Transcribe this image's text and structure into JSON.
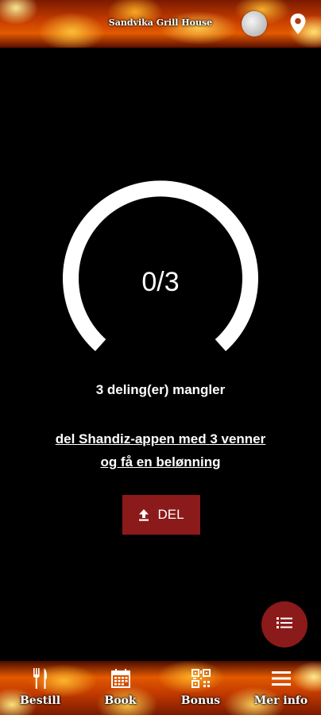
{
  "header": {
    "title": "Sandvika Grill House",
    "profile_icon": "profile-avatar-icon",
    "location_icon": "location-pin-icon"
  },
  "progress": {
    "current": 0,
    "total": 3,
    "label": "0/3",
    "remaining_text": "3 deling(er) mangler"
  },
  "share": {
    "link_text": "del Shandiz-appen med 3 venner og få en belønning",
    "button_label": "DEL",
    "button_icon": "upload-icon"
  },
  "fab": {
    "icon": "list-icon"
  },
  "bottom_nav": {
    "items": [
      {
        "label": "Bestill",
        "icon": "fork-knife-icon"
      },
      {
        "label": "Book",
        "icon": "calendar-icon"
      },
      {
        "label": "Bonus",
        "icon": "qr-code-icon"
      },
      {
        "label": "Mer info",
        "icon": "menu-icon"
      }
    ]
  },
  "colors": {
    "background": "#000000",
    "accent": "#8b1a1a",
    "text": "#ffffff"
  }
}
